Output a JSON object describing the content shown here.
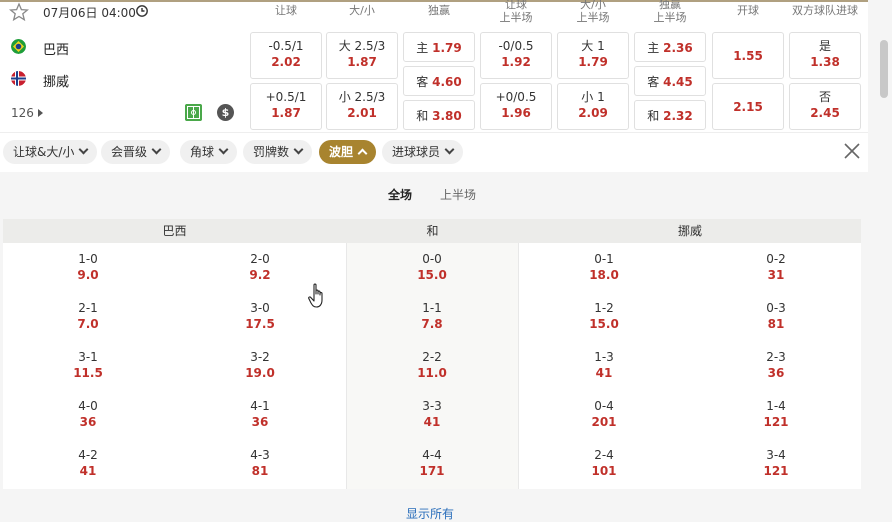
{
  "match": {
    "date": "07月06日 04:00",
    "home": "巴西",
    "away": "挪威",
    "count": "126"
  },
  "columns": [
    "让球",
    "大/小",
    "独赢",
    "让球\n上半场",
    "大/小\n上半场",
    "独赢\n上半场",
    "开球",
    "双方球队进球"
  ],
  "odds": {
    "hcap_home": {
      "label": "-0.5/1",
      "value": "2.02"
    },
    "hcap_away": {
      "label": "+0.5/1",
      "value": "1.87"
    },
    "ou_over": {
      "label": "大 2.5/3",
      "value": "1.87"
    },
    "ou_under": {
      "label": "小 2.5/3",
      "value": "2.01"
    },
    "ml_home": {
      "label": "主",
      "value": "1.79"
    },
    "ml_away": {
      "label": "客",
      "value": "4.60"
    },
    "ml_draw": {
      "label": "和",
      "value": "3.80"
    },
    "h1_hcap_home": {
      "label": "-0/0.5",
      "value": "1.92"
    },
    "h1_hcap_away": {
      "label": "+0/0.5",
      "value": "1.96"
    },
    "h1_ou_over": {
      "label": "大 1",
      "value": "1.79"
    },
    "h1_ou_under": {
      "label": "小 1",
      "value": "2.09"
    },
    "h1_ml_home": {
      "label": "主",
      "value": "2.36"
    },
    "h1_ml_away": {
      "label": "客",
      "value": "4.45"
    },
    "h1_ml_draw": {
      "label": "和",
      "value": "2.32"
    },
    "kickoff_1": "1.55",
    "kickoff_2": "2.15",
    "btts_yes": {
      "label": "是",
      "value": "1.38"
    },
    "btts_no": {
      "label": "否",
      "value": "2.45"
    }
  },
  "filters": [
    "让球&大/小",
    "会晋级",
    "角球",
    "罚牌数",
    "波胆",
    "进球球员"
  ],
  "active_filter": "波胆",
  "score_tabs": {
    "full": "全场",
    "half": "上半场"
  },
  "score_groups": {
    "home": "巴西",
    "draw": "和",
    "away": "挪威"
  },
  "scores": {
    "home_a": [
      [
        "1-0",
        "9.0"
      ],
      [
        "2-1",
        "7.0"
      ],
      [
        "3-1",
        "11.5"
      ],
      [
        "4-0",
        "36"
      ],
      [
        "4-2",
        "41"
      ]
    ],
    "home_b": [
      [
        "2-0",
        "9.2"
      ],
      [
        "3-0",
        "17.5"
      ],
      [
        "3-2",
        "19.0"
      ],
      [
        "4-1",
        "36"
      ],
      [
        "4-3",
        "81"
      ]
    ],
    "draw": [
      [
        "0-0",
        "15.0"
      ],
      [
        "1-1",
        "7.8"
      ],
      [
        "2-2",
        "11.0"
      ],
      [
        "3-3",
        "41"
      ],
      [
        "4-4",
        "171"
      ]
    ],
    "away_a": [
      [
        "0-1",
        "18.0"
      ],
      [
        "1-2",
        "15.0"
      ],
      [
        "1-3",
        "41"
      ],
      [
        "0-4",
        "201"
      ],
      [
        "2-4",
        "101"
      ]
    ],
    "away_b": [
      [
        "0-2",
        "31"
      ],
      [
        "0-3",
        "81"
      ],
      [
        "2-3",
        "36"
      ],
      [
        "1-4",
        "121"
      ],
      [
        "3-4",
        "121"
      ]
    ]
  },
  "show_all": "显示所有"
}
